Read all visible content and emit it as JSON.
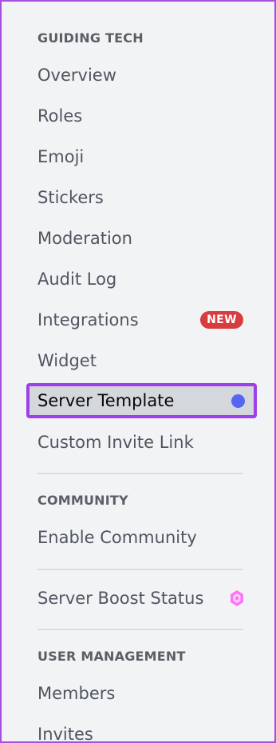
{
  "sections": {
    "guiding_tech": {
      "header": "GUIDING TECH",
      "items": [
        "Overview",
        "Roles",
        "Emoji",
        "Stickers",
        "Moderation",
        "Audit Log",
        "Integrations",
        "Widget",
        "Server Template",
        "Custom Invite Link"
      ],
      "integrations_badge": "NEW"
    },
    "community": {
      "header": "COMMUNITY",
      "items": [
        "Enable Community"
      ]
    },
    "boost": {
      "items": [
        "Server Boost Status"
      ]
    },
    "user_management": {
      "header": "USER MANAGEMENT",
      "items": [
        "Members",
        "Invites"
      ]
    }
  },
  "selected_item": "Server Template",
  "colors": {
    "background": "#f2f3f5",
    "selected_background": "#d4d7dc",
    "highlight_border": "#9e3fe7",
    "new_badge": "#d83c3e",
    "unread_dot": "#5865f2",
    "boost_icon": "#ff73fa"
  },
  "icons": {
    "unread_indicator": "dot-indicator-icon",
    "boost": "boost-gem-icon"
  }
}
